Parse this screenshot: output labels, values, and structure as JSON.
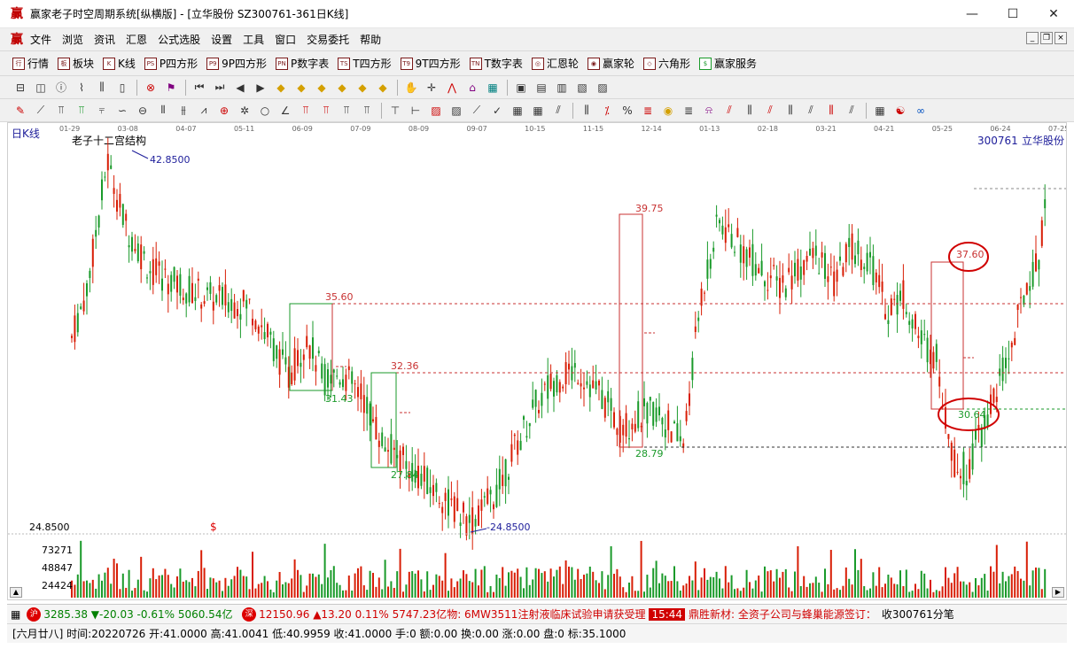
{
  "window": {
    "title": "赢家老子时空周期系统[纵横版] - [立华股份  SZ300761-361日K线]",
    "min": "—",
    "max": "☐",
    "close": "✕"
  },
  "menu": [
    "文件",
    "浏览",
    "资讯",
    "汇恩",
    "公式选股",
    "设置",
    "工具",
    "窗口",
    "交易委托",
    "帮助"
  ],
  "toolbar1": [
    {
      "icon": "行",
      "label": "行情"
    },
    {
      "icon": "板",
      "label": "板块"
    },
    {
      "icon": "K",
      "label": "K线"
    },
    {
      "icon": "PS",
      "label": "P四方形"
    },
    {
      "icon": "P9",
      "label": "9P四方形"
    },
    {
      "icon": "PN",
      "label": "P数字表"
    },
    {
      "icon": "TS",
      "label": "T四方形"
    },
    {
      "icon": "T9",
      "label": "9T四方形"
    },
    {
      "icon": "TN",
      "label": "T数字表"
    },
    {
      "icon": "◎",
      "label": "汇恩轮"
    },
    {
      "icon": "◉",
      "label": "赢家轮"
    },
    {
      "icon": "◇",
      "label": "六角形"
    },
    {
      "icon": "$",
      "label": "赢家服务"
    }
  ],
  "chart": {
    "period_label": "日K线",
    "indicator_title": "老子十二宫结构",
    "code": "300761",
    "name": "立华股份",
    "left_axis_label": "24.8500",
    "volume_axis": [
      "73271",
      "48847",
      "24424"
    ],
    "dates": [
      "01-29",
      "03-08",
      "04-07",
      "05-11",
      "06-09",
      "07-09",
      "08-09",
      "09-07",
      "10-15",
      "11-15",
      "12-14",
      "01-13",
      "02-18",
      "03-21",
      "04-21",
      "05-25",
      "06-24",
      "07-25"
    ],
    "annotations": {
      "high": "42.8500",
      "low": "-24.8500",
      "a1": "35.60",
      "a2": "31.43",
      "a3": "32.36",
      "a4": "27.84",
      "a5": "39.75",
      "a6": "28.79",
      "a7": "37.60",
      "a8": "30.64",
      "dollar": "$"
    }
  },
  "status1": {
    "sh_icon": "沪",
    "sh_text": "3285.38",
    "sh_change": "▼-20.03",
    "sh_pct": "-0.61%",
    "sh_amt": "5060.54亿",
    "sz_icon": "深",
    "sz_text": "12150.96",
    "sz_change": "▲13.20",
    "sz_pct": "0.11%",
    "sz_amt": "5747.23亿",
    "news1": "物:  6MW3511注射液临床试验申请获受理",
    "time": "15:44",
    "news2": "鼎胜新材:  全资子公司与蜂巢能源签订：",
    "news3": "收300761分笔"
  },
  "status2": {
    "text": "[六月廿八] 时间:20220726 开:41.0000 高:41.0041 低:40.9959 收:41.0000 手:0 额:0.00 换:0.00 涨:0.00 盘:0 标:35.1000"
  },
  "colors": {
    "up": "#d81e06",
    "down": "#1a9a2a",
    "accent": "#d00000",
    "axis": "#1d1d9a"
  }
}
